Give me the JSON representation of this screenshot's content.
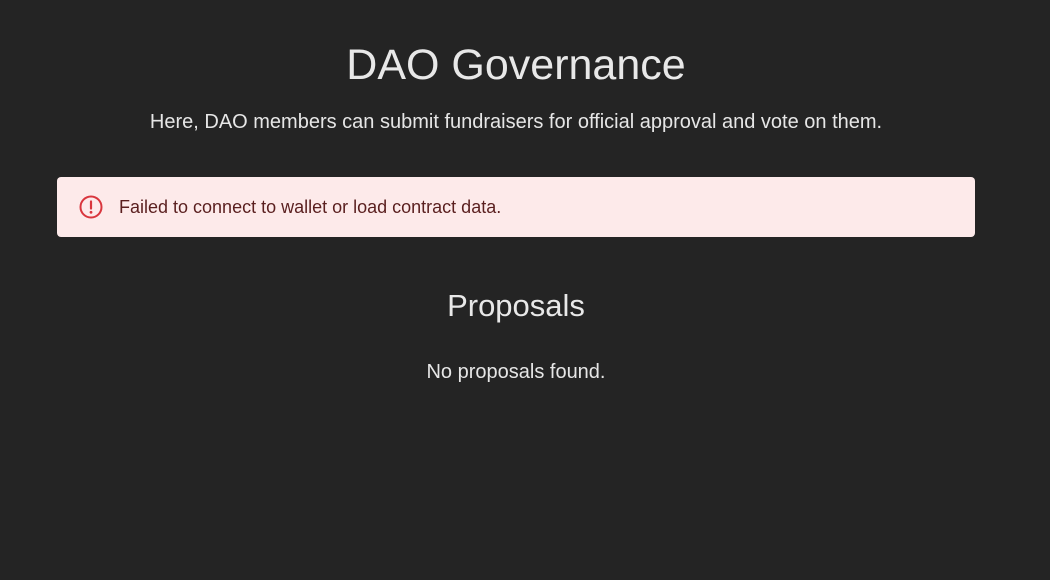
{
  "header": {
    "title": "DAO Governance",
    "subtitle": "Here, DAO members can submit fundraisers for official approval and vote on them."
  },
  "alert": {
    "icon": "exclamation-circle-icon",
    "message": "Failed to connect to wallet or load contract data.",
    "colors": {
      "background": "#fdeaea",
      "icon": "#d9363e",
      "text": "#5a1f1f"
    }
  },
  "proposals": {
    "heading": "Proposals",
    "empty_message": "No proposals found."
  }
}
